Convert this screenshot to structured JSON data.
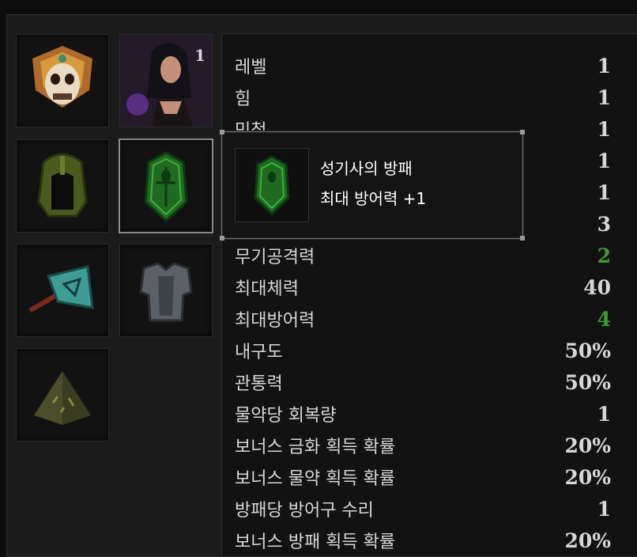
{
  "equipment": {
    "slots": [
      {
        "name": "helmet-mask",
        "icon": "tribal-mask-icon"
      },
      {
        "name": "companion",
        "icon": "portrait-woman-icon",
        "count": "1"
      },
      {
        "name": "armor-helmet",
        "icon": "green-helmet-icon"
      },
      {
        "name": "shield",
        "icon": "paladin-shield-icon"
      },
      {
        "name": "weapon",
        "icon": "axe-icon"
      },
      {
        "name": "body-armor",
        "icon": "chest-armor-icon"
      },
      {
        "name": "accessory",
        "icon": "pyramid-rune-icon"
      }
    ]
  },
  "stats": [
    {
      "label": "레벨",
      "value": "1",
      "color": "#d7d7d7"
    },
    {
      "label": "힘",
      "value": "1",
      "color": "#d7d7d7"
    },
    {
      "label": "민첩",
      "value": "1",
      "color": "#d7d7d7"
    },
    {
      "label": "",
      "value": "1",
      "color": "#d7d7d7"
    },
    {
      "label": "",
      "value": "1",
      "color": "#d7d7d7"
    },
    {
      "label": "",
      "value": "3",
      "color": "#d7d7d7"
    },
    {
      "label": "무기공격력",
      "value": "2",
      "color": "#3e9d2d"
    },
    {
      "label": "최대체력",
      "value": "40",
      "color": "#d7d7d7"
    },
    {
      "label": "최대방어력",
      "value": "4",
      "color": "#3e9d2d"
    },
    {
      "label": "내구도",
      "value": "50%",
      "color": "#d7d7d7"
    },
    {
      "label": "관통력",
      "value": "50%",
      "color": "#d7d7d7"
    },
    {
      "label": "물약당 회복량",
      "value": "1",
      "color": "#d7d7d7"
    },
    {
      "label": "보너스 금화 획득 확률",
      "value": "20%",
      "color": "#d7d7d7"
    },
    {
      "label": "보너스 물약 획득 확률",
      "value": "20%",
      "color": "#d7d7d7"
    },
    {
      "label": "방패당 방어구 수리",
      "value": "1",
      "color": "#d7d7d7"
    },
    {
      "label": "보너스 방패 획득 확률",
      "value": "20%",
      "color": "#d7d7d7"
    }
  ],
  "tooltip": {
    "item_name": "성기사의 방패",
    "item_stat": "최대 방어력 +1"
  }
}
